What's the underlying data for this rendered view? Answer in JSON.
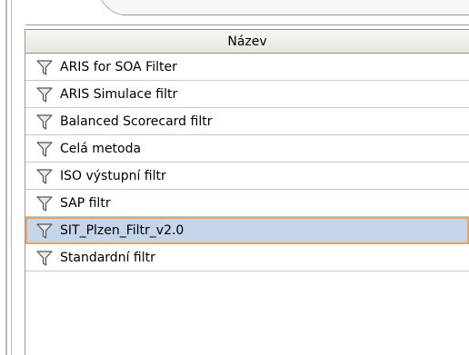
{
  "table": {
    "header": "Název",
    "rows": [
      {
        "label": "ARIS for SOA Filter",
        "icon": "filter-icon",
        "selected": false
      },
      {
        "label": "ARIS Simulace filtr",
        "icon": "filter-icon",
        "selected": false
      },
      {
        "label": "Balanced Scorecard filtr",
        "icon": "filter-icon",
        "selected": false
      },
      {
        "label": "Celá metoda",
        "icon": "filter-icon",
        "selected": false
      },
      {
        "label": "ISO výstupní filtr",
        "icon": "filter-icon",
        "selected": false
      },
      {
        "label": "SAP filtr",
        "icon": "filter-icon",
        "selected": false
      },
      {
        "label": "SIT_Plzen_Filtr_v2.0",
        "icon": "filter-icon",
        "selected": true
      },
      {
        "label": "Standardní filtr",
        "icon": "filter-icon",
        "selected": false
      }
    ]
  },
  "colors": {
    "selected_row_bg": "#c5d5ea",
    "selected_row_border": "#e8a55a",
    "header_bg": "#e6e6df"
  }
}
